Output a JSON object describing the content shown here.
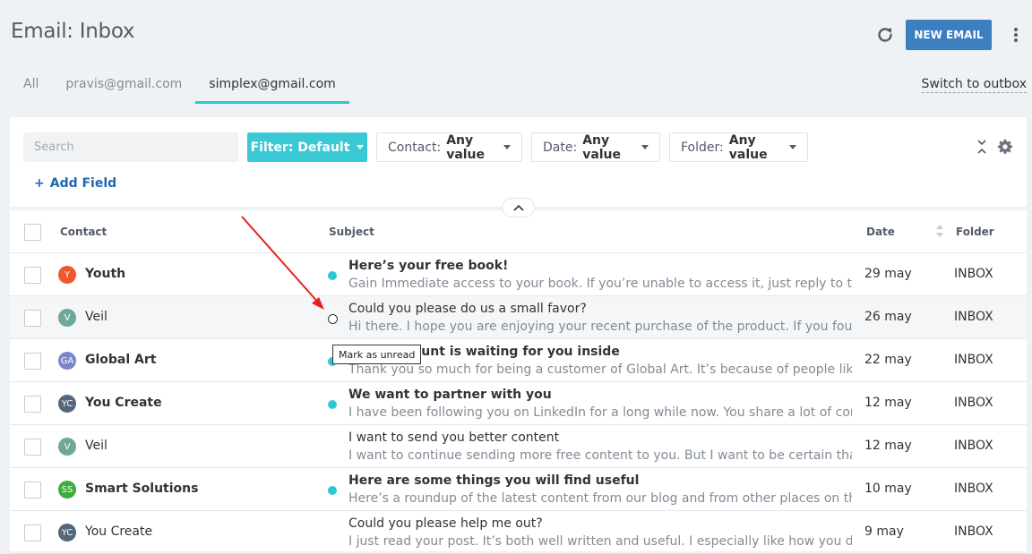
{
  "header": {
    "title": "Email: Inbox",
    "new_email_label": "NEW EMAIL"
  },
  "tabs": [
    {
      "label": "All"
    },
    {
      "label": "pravis@gmail.com"
    },
    {
      "label": "simplex@gmail.com",
      "active": true
    }
  ],
  "switch_outbox_label": "Switch to outbox",
  "filters": {
    "search_placeholder": "Search",
    "filter_label": "Filter: Default",
    "contact_label": "Contact:",
    "contact_value": "Any value",
    "date_label": "Date:",
    "date_value": "Any value",
    "folder_label": "Folder:",
    "folder_value": "Any value",
    "add_field_label": "Add Field"
  },
  "columns": {
    "contact": "Contact",
    "subject": "Subject",
    "date": "Date",
    "folder": "Folder"
  },
  "tooltip": "Mark as unread",
  "colors": {
    "accent": "#2fc6d7",
    "primary": "#3b7fc1",
    "link": "#2067b0"
  },
  "rows": [
    {
      "initials": "Y",
      "color": "#f0572d",
      "contact": "Youth",
      "subject": "Here’s your free book!",
      "snippet": "Gain Immediate access to your book. If you’re unable to access it, just reply to this email",
      "date": "29 may",
      "folder": "INBOX",
      "unread": true
    },
    {
      "initials": "V",
      "color": "#6fa898",
      "contact": "Veil",
      "subject": "Could you please do us a small favor?",
      "snippet": "Hi there. I hope you are enjoying your recent purchase of the product. If you found it useful",
      "date": "26 may",
      "folder": "INBOX",
      "unread": false
    },
    {
      "initials": "GA",
      "color": "#7b86c9",
      "contact": "Global Art",
      "subject": "Your discount is waiting for you inside",
      "snippet": "Thank you so much for being a customer of Global Art. It’s because of people like you we",
      "date": "22 may",
      "folder": "INBOX",
      "unread": true
    },
    {
      "initials": "YC",
      "color": "#54687a",
      "contact": "You Create",
      "subject": "We want to partner with you",
      "snippet": "I have been following you on LinkedIn for a long while now. You share a lot of content, and",
      "date": "12 may",
      "folder": "INBOX",
      "unread": true
    },
    {
      "initials": "V",
      "color": "#6fa898",
      "contact": "Veil",
      "subject": "I want to send you better content",
      "snippet": "I want to continue sending more free content to you. But I want to be certain that I am",
      "date": "12 may",
      "folder": "INBOX",
      "unread": false
    },
    {
      "initials": "SS",
      "color": "#3aaf3c",
      "contact": "Smart Solutions",
      "subject": "Here are some things you will find useful",
      "snippet": "Here’s a roundup of the latest content from our blog and from other places on the web",
      "date": "10 may",
      "folder": "INBOX",
      "unread": true
    },
    {
      "initials": "YC",
      "color": "#54687a",
      "contact": "You Create",
      "subject": "Could you please help me out?",
      "snippet": "I just read your post. It’s both well written and useful. I especially like how you described",
      "date": "9 may",
      "folder": "INBOX",
      "unread": false
    }
  ]
}
